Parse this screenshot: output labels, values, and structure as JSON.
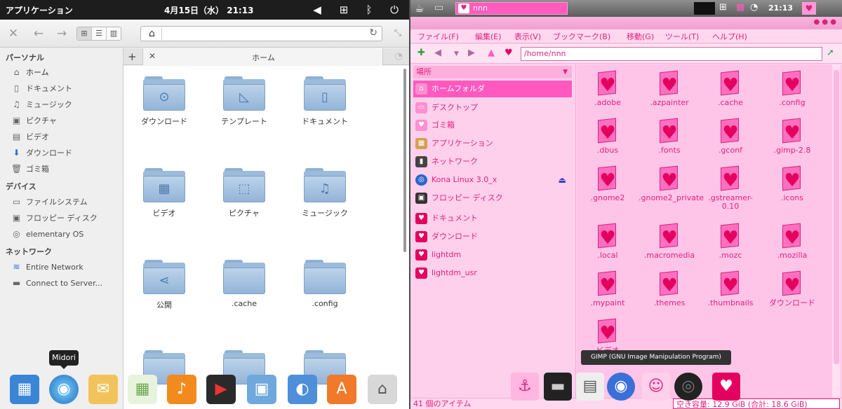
{
  "left": {
    "panel": {
      "app_menu": "アプリケーション",
      "clock": "4月15日（水） 21:13"
    },
    "toolbar": {
      "view_modes": [
        "⊞",
        "☰",
        "▥"
      ]
    },
    "sidebar": {
      "personal_header": "パーソナル",
      "personal": [
        "ホーム",
        "ドキュメント",
        "ミュージック",
        "ピクチャ",
        "ビデオ",
        "ダウンロード",
        "ゴミ箱"
      ],
      "devices_header": "デバイス",
      "devices": [
        "ファイルシステム",
        "フロッピー ディスク",
        "elementary OS"
      ],
      "network_header": "ネットワーク",
      "network": [
        "Entire Network",
        "Connect to Server..."
      ]
    },
    "tab": {
      "label": "ホーム"
    },
    "files": [
      "ダウンロード",
      "テンプレート",
      "ドキュメント",
      "ビデオ",
      "ピクチャ",
      "ミュージック",
      "公開",
      ".cache",
      ".config"
    ],
    "dock_tooltip": "Midori"
  },
  "right": {
    "taskbar": {
      "window_label": "nnn",
      "clock": "21:13"
    },
    "menu": [
      "ファイル(F)",
      "編集(E)",
      "表示(V)",
      "ブックマーク(B)",
      "移動(G)",
      "ツール(T)",
      "ヘルプ(H)"
    ],
    "location": "/home/nnn",
    "places_header": "場所",
    "places": [
      "ホームフォルダ",
      "デスクトップ",
      "ゴミ箱",
      "アプリケーション",
      "ネットワーク",
      "Kona Linux 3.0_x",
      "フロッピー ディスク",
      "ドキュメント",
      "ダウンロード",
      "lightdm",
      "lightdm_usr"
    ],
    "files": [
      ".adobe",
      ".azpainter",
      ".cache",
      ".config",
      ".dbus",
      ".fonts",
      ".gconf",
      ".gimp-2.8",
      ".gnome2",
      ".gnome2_private",
      ".gstreamer-0.10",
      ".icons",
      ".local",
      ".macromedia",
      ".mozc",
      ".mozilla",
      ".mypaint",
      ".themes",
      ".thumbnails",
      "ダウンロード",
      "ビデオ"
    ],
    "tooltip": "GIMP (GNU Image Manipulation Program)",
    "status": {
      "count": "41 個のアイテム",
      "free": "空き容量: 12.9 GiB (合計: 18.6 GiB)"
    }
  }
}
